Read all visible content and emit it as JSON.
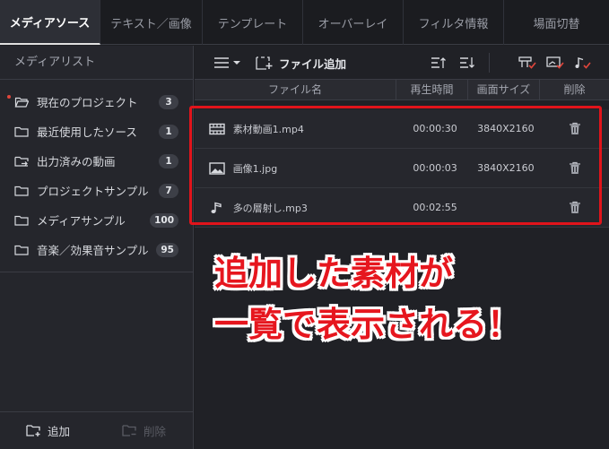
{
  "tabs": [
    "メディアソース",
    "テキスト／画像",
    "テンプレート",
    "オーバーレイ",
    "フィルタ情報",
    "場面切替"
  ],
  "sidebar": {
    "title": "メディアリスト",
    "items": [
      {
        "label": "現在のプロジェクト",
        "count": "3",
        "icon": "folder-open-icon",
        "active": true
      },
      {
        "label": "最近使用したソース",
        "count": "1",
        "icon": "folder-icon"
      },
      {
        "label": "出力済みの動画",
        "count": "1",
        "icon": "folder-export-icon"
      },
      {
        "label": "プロジェクトサンプル",
        "count": "7",
        "icon": "folder-icon"
      },
      {
        "label": "メディアサンプル",
        "count": "100",
        "icon": "folder-icon"
      },
      {
        "label": "音楽／効果音サンプル",
        "count": "95",
        "icon": "folder-icon"
      }
    ],
    "add_label": "追加",
    "delete_label": "削除"
  },
  "toolbar": {
    "add_file_label": "ファイル追加"
  },
  "columns": {
    "name": "ファイル名",
    "duration": "再生時間",
    "size": "画面サイズ",
    "delete": "削除"
  },
  "files": [
    {
      "name": "素材動画1.mp4",
      "duration": "00:00:30",
      "size": "3840X2160",
      "icon": "film-icon"
    },
    {
      "name": "画像1.jpg",
      "duration": "00:00:03",
      "size": "3840X2160",
      "icon": "image-icon"
    },
    {
      "name": "多の層射し.mp3",
      "duration": "00:02:55",
      "size": "",
      "icon": "music-note-icon"
    }
  ],
  "annotation": {
    "line1": "追加した素材が",
    "line2": "一覧で表示される！"
  },
  "colors": {
    "highlight": "#e1141b",
    "accent_dot": "#e0463c"
  }
}
